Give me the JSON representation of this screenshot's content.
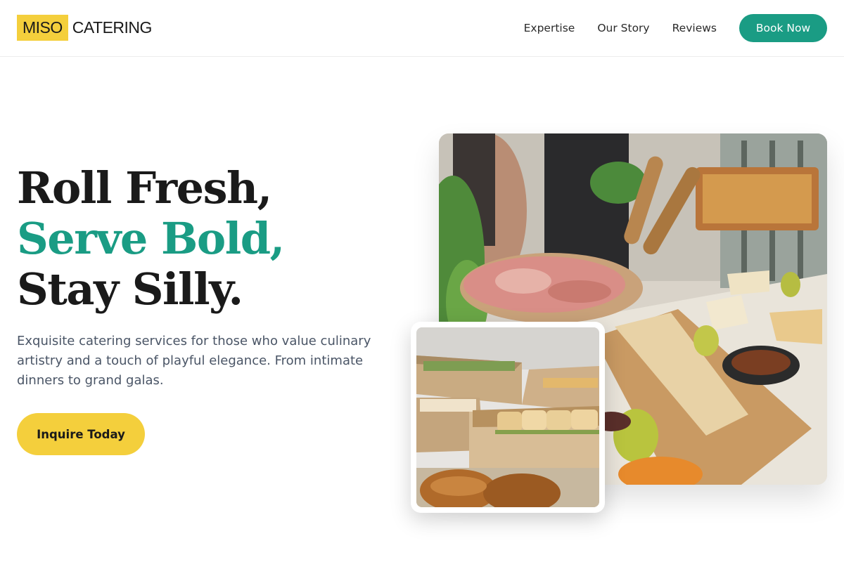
{
  "brand": {
    "highlight": "MISO",
    "name": "CATERING"
  },
  "nav": {
    "links": [
      "Expertise",
      "Our Story",
      "Reviews"
    ],
    "cta": "Book Now"
  },
  "hero": {
    "headline": [
      "Roll Fresh,",
      "Serve Bold,",
      "Stay Silly."
    ],
    "subtext": "Exquisite catering services for those who value culinary artistry and a touch of playful elegance. From intimate dinners to grand galas.",
    "cta": "Inquire Today"
  },
  "colors": {
    "accent": "#1a9c84",
    "brand_yellow": "#f4cf3c",
    "text_dark": "#1a1a1a",
    "text_muted": "#4a5566"
  }
}
